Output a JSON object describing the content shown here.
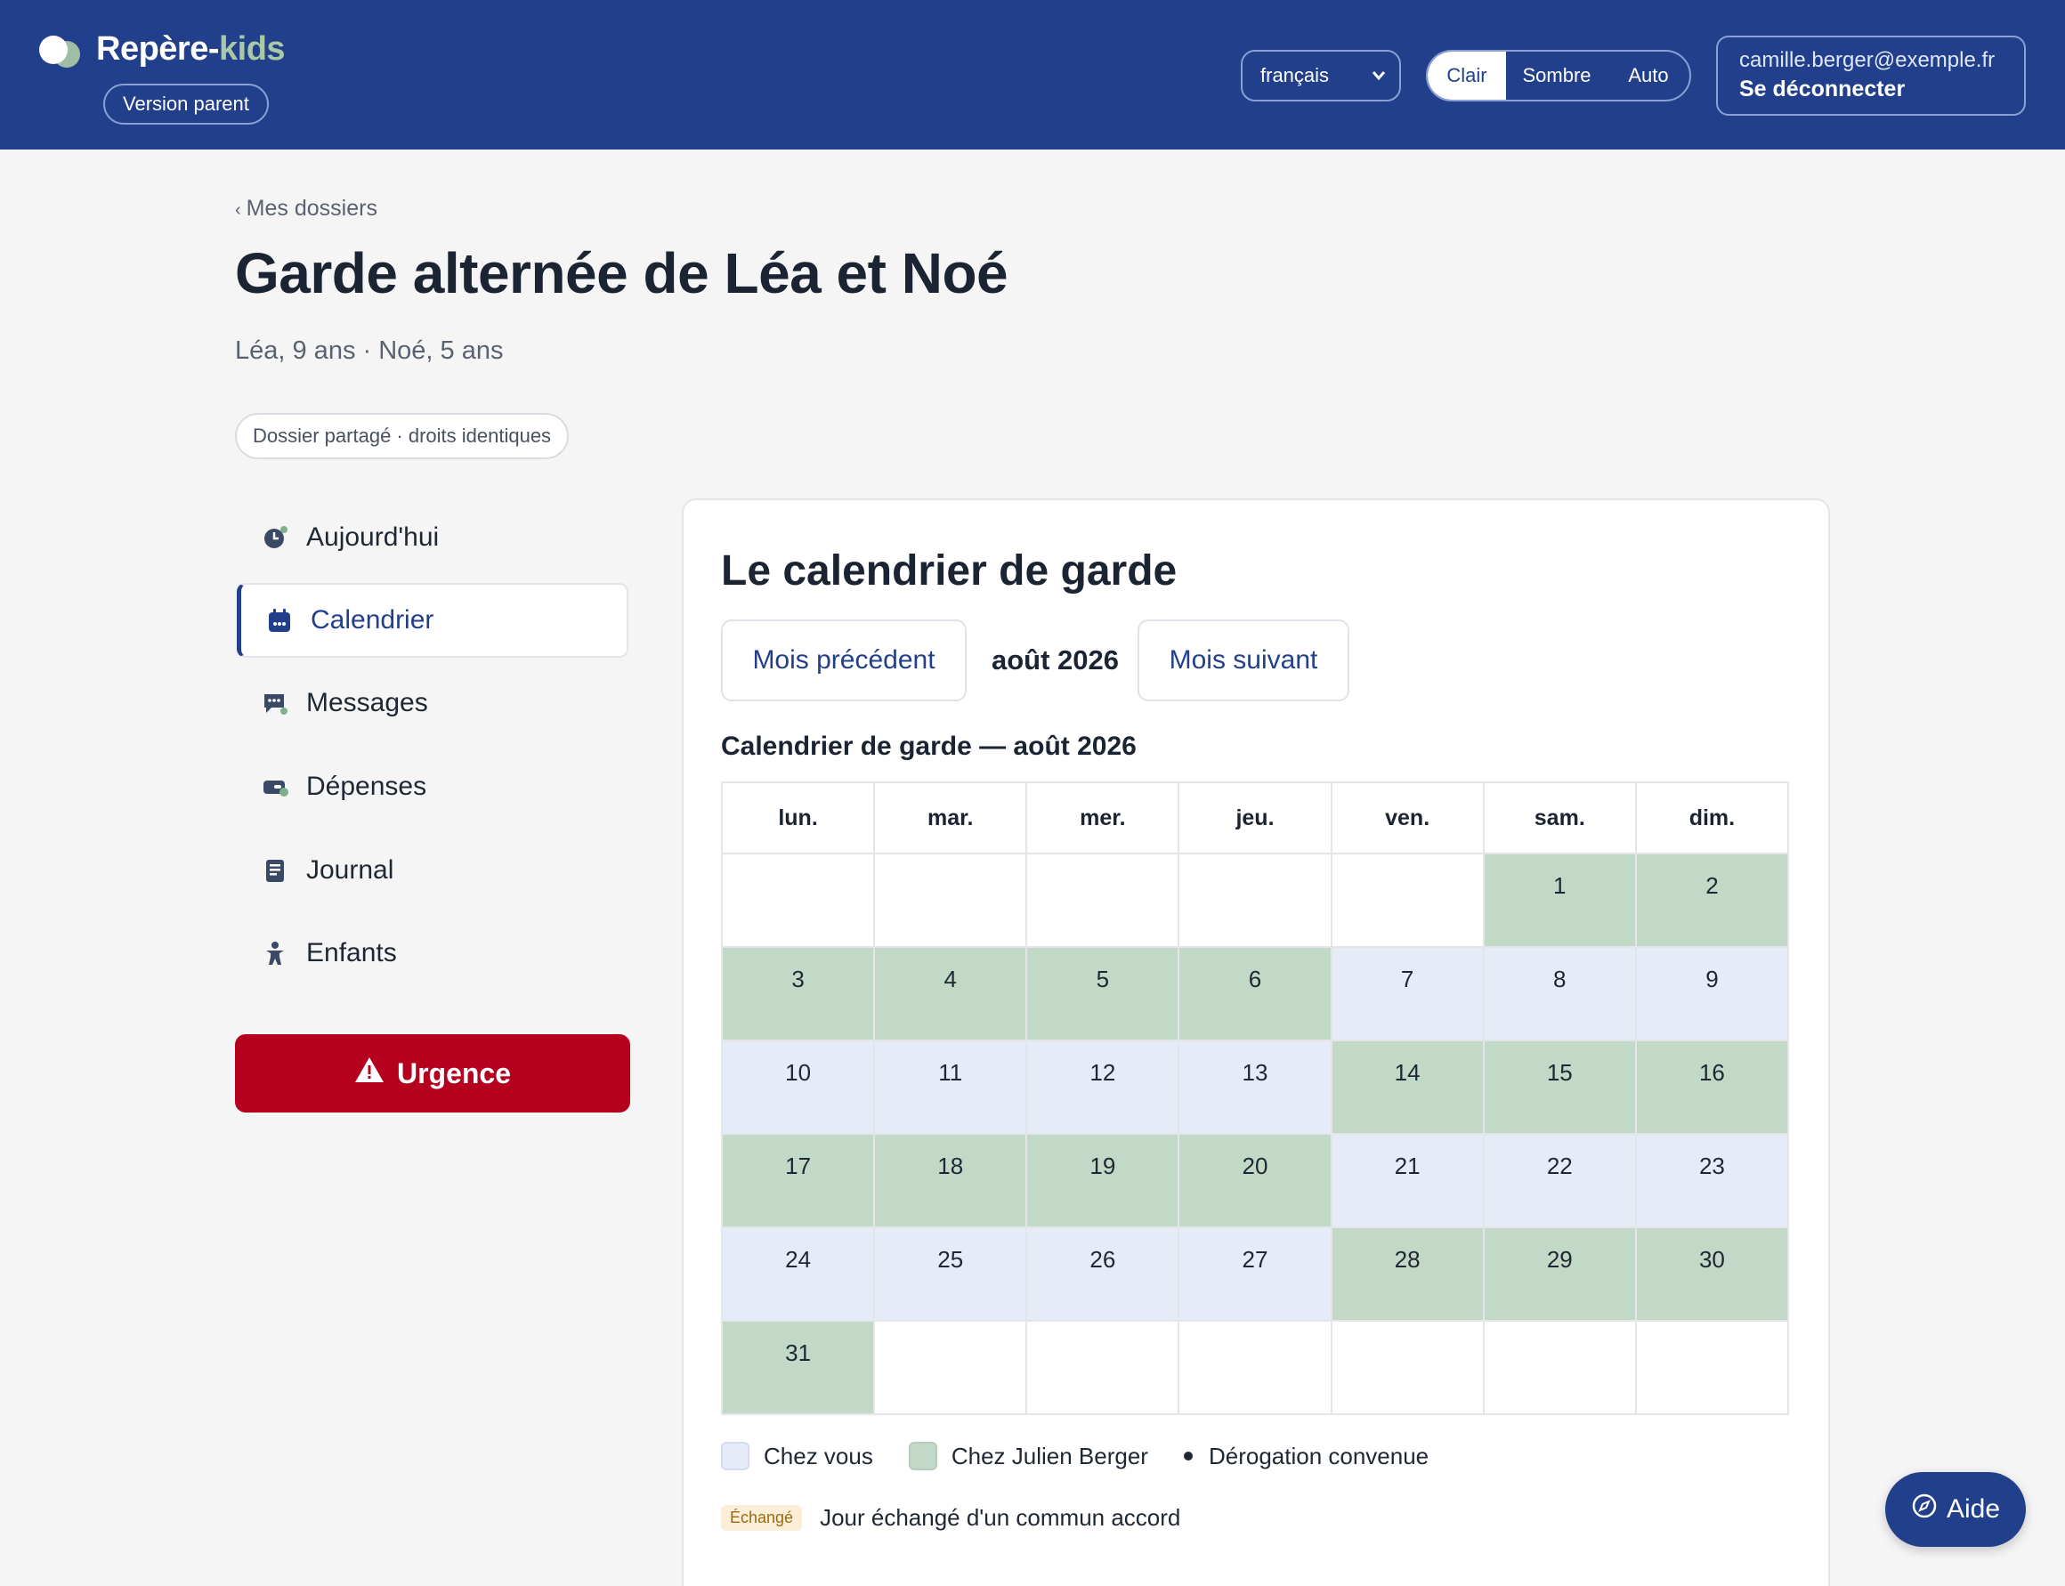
{
  "header": {
    "brand_main": "Repère-",
    "brand_accent": "kids",
    "version_label": "Version parent",
    "language": "français",
    "theme_options": [
      "Clair",
      "Sombre",
      "Auto"
    ],
    "theme_selected": "Clair",
    "account_email": "camille.berger@exemple.fr",
    "logout_label": "Se déconnecter"
  },
  "page": {
    "breadcrumb": "Mes dossiers",
    "title": "Garde alternée de Léa et Noé",
    "subtitle": "Léa, 9 ans · Noé, 5 ans",
    "share_badge": "Dossier partagé · droits identiques"
  },
  "sidebar": {
    "items": [
      {
        "label": "Aujourd'hui",
        "icon": "clock-icon"
      },
      {
        "label": "Calendrier",
        "icon": "calendar-icon",
        "active": true
      },
      {
        "label": "Messages",
        "icon": "message-icon"
      },
      {
        "label": "Dépenses",
        "icon": "wallet-icon"
      },
      {
        "label": "Journal",
        "icon": "journal-icon"
      },
      {
        "label": "Enfants",
        "icon": "child-icon"
      }
    ],
    "urgent_label": "Urgence"
  },
  "calendar": {
    "heading": "Le calendrier de garde",
    "prev_label": "Mois précédent",
    "next_label": "Mois suivant",
    "month_label": "août 2026",
    "caption": "Calendrier de garde — août 2026",
    "weekdays": [
      "lun.",
      "mar.",
      "mer.",
      "jeu.",
      "ven.",
      "sam.",
      "dim."
    ],
    "weeks": [
      [
        null,
        null,
        null,
        null,
        null,
        {
          "d": "1",
          "p": "julien"
        },
        {
          "d": "2",
          "p": "julien"
        }
      ],
      [
        {
          "d": "3",
          "p": "julien"
        },
        {
          "d": "4",
          "p": "julien"
        },
        {
          "d": "5",
          "p": "julien"
        },
        {
          "d": "6",
          "p": "julien"
        },
        {
          "d": "7",
          "p": "vous"
        },
        {
          "d": "8",
          "p": "vous"
        },
        {
          "d": "9",
          "p": "vous"
        }
      ],
      [
        {
          "d": "10",
          "p": "vous"
        },
        {
          "d": "11",
          "p": "vous"
        },
        {
          "d": "12",
          "p": "vous"
        },
        {
          "d": "13",
          "p": "vous"
        },
        {
          "d": "14",
          "p": "julien"
        },
        {
          "d": "15",
          "p": "julien"
        },
        {
          "d": "16",
          "p": "julien"
        }
      ],
      [
        {
          "d": "17",
          "p": "julien"
        },
        {
          "d": "18",
          "p": "julien"
        },
        {
          "d": "19",
          "p": "julien"
        },
        {
          "d": "20",
          "p": "julien"
        },
        {
          "d": "21",
          "p": "vous"
        },
        {
          "d": "22",
          "p": "vous"
        },
        {
          "d": "23",
          "p": "vous"
        }
      ],
      [
        {
          "d": "24",
          "p": "vous"
        },
        {
          "d": "25",
          "p": "vous"
        },
        {
          "d": "26",
          "p": "vous"
        },
        {
          "d": "27",
          "p": "vous"
        },
        {
          "d": "28",
          "p": "julien"
        },
        {
          "d": "29",
          "p": "julien"
        },
        {
          "d": "30",
          "p": "julien"
        }
      ],
      [
        {
          "d": "31",
          "p": "julien"
        },
        null,
        null,
        null,
        null,
        null,
        null
      ]
    ],
    "legend": {
      "vous": "Chez vous",
      "julien": "Chez Julien Berger",
      "derogation": "Dérogation convenue"
    },
    "exchange_tag": "Échangé",
    "exchange_desc": "Jour échangé d'un commun accord"
  },
  "help_label": "Aide",
  "colors": {
    "brand": "#223f8c",
    "vous": "#e6ebf8",
    "julien": "#c3d9c7",
    "urgent": "#b5001e"
  }
}
